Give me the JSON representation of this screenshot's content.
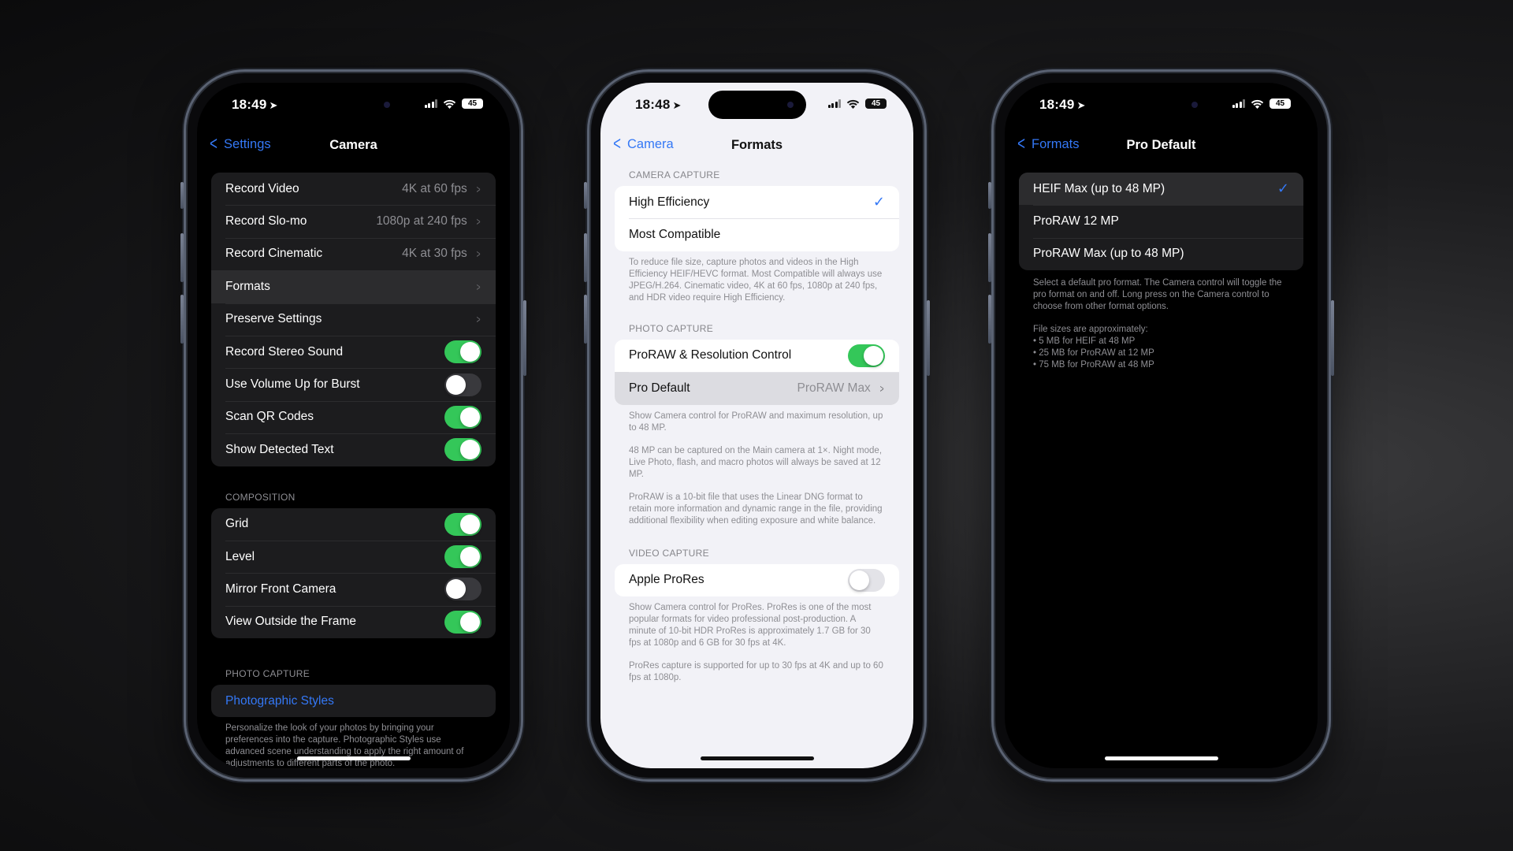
{
  "colors": {
    "accent": "#3478f6",
    "toggle_on": "#34c759",
    "dark_bg": "#000000",
    "dark_cell": "#1c1c1e",
    "light_bg": "#f2f2f7"
  },
  "phones": [
    {
      "theme": "dark",
      "status": {
        "time": "18:49",
        "battery": "45"
      },
      "nav": {
        "back_label": "Settings",
        "title": "Camera"
      },
      "group1": [
        {
          "label": "Record Video",
          "value": "4K at 60 fps",
          "type": "disclosure"
        },
        {
          "label": "Record Slo-mo",
          "value": "1080p at 240 fps",
          "type": "disclosure"
        },
        {
          "label": "Record Cinematic",
          "value": "4K at 30 fps",
          "type": "disclosure"
        },
        {
          "label": "Formats",
          "value": "",
          "type": "disclosure",
          "highlighted": true
        },
        {
          "label": "Preserve Settings",
          "value": "",
          "type": "disclosure"
        },
        {
          "label": "Record Stereo Sound",
          "type": "toggle",
          "on": true
        },
        {
          "label": "Use Volume Up for Burst",
          "type": "toggle",
          "on": false
        },
        {
          "label": "Scan QR Codes",
          "type": "toggle",
          "on": true
        },
        {
          "label": "Show Detected Text",
          "type": "toggle",
          "on": true
        }
      ],
      "composition": {
        "header": "COMPOSITION",
        "items": [
          {
            "label": "Grid",
            "on": true
          },
          {
            "label": "Level",
            "on": true
          },
          {
            "label": "Mirror Front Camera",
            "on": false
          },
          {
            "label": "View Outside the Frame",
            "on": true
          }
        ]
      },
      "photo_capture": {
        "header": "PHOTO CAPTURE",
        "link_label": "Photographic Styles",
        "footer": "Personalize the look of your photos by bringing your preferences into the capture. Photographic Styles use advanced scene understanding to apply the right amount of adjustments to different parts of the photo."
      }
    },
    {
      "theme": "light",
      "status": {
        "time": "18:48",
        "battery": "45"
      },
      "nav": {
        "back_label": "Camera",
        "title": "Formats"
      },
      "camera_capture": {
        "header": "CAMERA CAPTURE",
        "options": [
          {
            "label": "High Efficiency",
            "selected": true
          },
          {
            "label": "Most Compatible",
            "selected": false
          }
        ],
        "footer": "To reduce file size, capture photos and videos in the High Efficiency HEIF/HEVC format. Most Compatible will always use JPEG/H.264. Cinematic video, 4K at 60 fps, 1080p at 240 fps, and HDR video require High Efficiency."
      },
      "photo_capture": {
        "header": "PHOTO CAPTURE",
        "proraw_label": "ProRAW & Resolution Control",
        "proraw_on": true,
        "pro_default_label": "Pro Default",
        "pro_default_value": "ProRAW Max",
        "footer": [
          "Show Camera control for ProRAW and maximum resolution, up to 48 MP.",
          "48 MP can be captured on the Main camera at 1×. Night mode, Live Photo, flash, and macro photos will always be saved at 12 MP.",
          "ProRAW is a 10-bit file that uses the Linear DNG format to retain more information and dynamic range in the file, providing additional flexibility when editing exposure and white balance."
        ]
      },
      "video_capture": {
        "header": "VIDEO CAPTURE",
        "prores_label": "Apple ProRes",
        "prores_on": false,
        "footer": [
          "Show Camera control for ProRes. ProRes is one of the most popular formats for video professional post-production. A minute of 10-bit HDR ProRes is approximately 1.7 GB for 30 fps at 1080p and 6 GB for 30 fps at 4K.",
          "ProRes capture is supported for up to 30 fps at 4K and up to 60 fps at 1080p."
        ]
      }
    },
    {
      "theme": "dark",
      "status": {
        "time": "18:49",
        "battery": "45"
      },
      "nav": {
        "back_label": "Formats",
        "title": "Pro Default"
      },
      "options": [
        {
          "label": "HEIF Max (up to 48 MP)",
          "selected": true
        },
        {
          "label": "ProRAW 12 MP",
          "selected": false
        },
        {
          "label": "ProRAW Max (up to 48 MP)",
          "selected": false
        }
      ],
      "footer": "Select a default pro format. The Camera control will toggle the pro format on and off. Long press on the Camera control to choose from other format options.",
      "sizes_intro": "File sizes are approximately:",
      "sizes": [
        "• 5 MB for HEIF at 48 MP",
        "• 25 MB for ProRAW at 12 MP",
        "• 75 MB for ProRAW at 48 MP"
      ]
    }
  ],
  "icons": {
    "location": "location-arrow-icon",
    "signal": "cellular-signal-icon",
    "wifi": "wifi-icon",
    "battery": "battery-icon",
    "back": "chevron-left-icon",
    "disclosure": "chevron-right-icon",
    "check": "checkmark-icon"
  }
}
